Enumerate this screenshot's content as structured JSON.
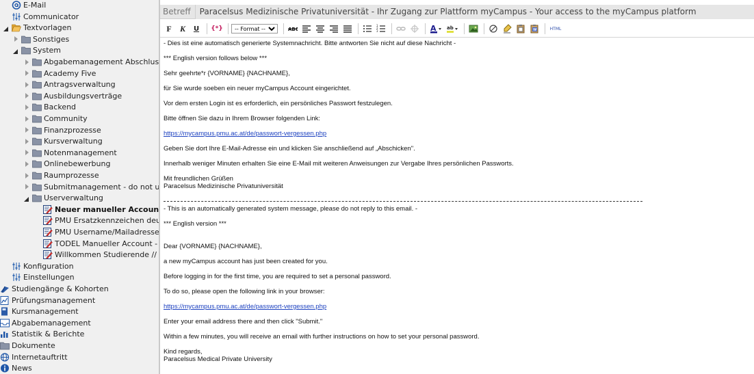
{
  "sidebar": {
    "items": [
      {
        "label": "E-Mail",
        "icon": "at-icon",
        "expander": "blank"
      },
      {
        "label": "Communicator",
        "icon": "sliders-icon",
        "expander": "blank"
      },
      {
        "label": "Textvorlagen",
        "icon": "folder-open-icon",
        "expander": "expanded"
      },
      {
        "label": "Sonstiges",
        "icon": "folder-icon",
        "expander": "collapsed"
      },
      {
        "label": "System",
        "icon": "folder-icon",
        "expander": "expanded"
      },
      {
        "label": "Abgabemanagement Abschlussar",
        "icon": "folder-icon",
        "expander": "collapsed"
      },
      {
        "label": "Academy Five",
        "icon": "folder-icon",
        "expander": "collapsed"
      },
      {
        "label": "Antragsverwaltung",
        "icon": "folder-icon",
        "expander": "collapsed"
      },
      {
        "label": "Ausbildungsverträge",
        "icon": "folder-icon",
        "expander": "collapsed"
      },
      {
        "label": "Backend",
        "icon": "folder-icon",
        "expander": "collapsed"
      },
      {
        "label": "Community",
        "icon": "folder-icon",
        "expander": "collapsed"
      },
      {
        "label": "Finanzprozesse",
        "icon": "folder-icon",
        "expander": "collapsed"
      },
      {
        "label": "Kursverwaltung",
        "icon": "folder-icon",
        "expander": "collapsed"
      },
      {
        "label": "Notenmanagement",
        "icon": "folder-icon",
        "expander": "collapsed"
      },
      {
        "label": "Onlinebewerbung",
        "icon": "folder-icon",
        "expander": "collapsed"
      },
      {
        "label": "Raumprozesse",
        "icon": "folder-icon",
        "expander": "collapsed"
      },
      {
        "label": "Submitmanagement - do not use",
        "icon": "folder-icon",
        "expander": "collapsed"
      },
      {
        "label": "Userverwaltung",
        "icon": "folder-icon",
        "expander": "expanded"
      },
      {
        "label": "Neuer manueller Account",
        "icon": "edit-template-icon",
        "expander": "blank",
        "active": true
      },
      {
        "label": "PMU Ersatzkennzeichen deuts",
        "icon": "edit-template-icon",
        "expander": "blank"
      },
      {
        "label": "PMU Username/Mailadresse v",
        "icon": "edit-template-icon",
        "expander": "blank"
      },
      {
        "label": "TODEL Manueller Account - m",
        "icon": "edit-template-icon",
        "expander": "blank"
      },
      {
        "label": "Willkommen Studierende // W",
        "icon": "edit-template-icon",
        "expander": "blank"
      },
      {
        "label": "Konfiguration",
        "icon": "sliders-icon",
        "expander": "blank"
      },
      {
        "label": "Einstellungen",
        "icon": "sliders-icon",
        "expander": "blank"
      },
      {
        "label": "Studiengänge & Kohorten",
        "icon": "graduation-icon",
        "expander": "none"
      },
      {
        "label": "Prüfungsmanagement",
        "icon": "chart-doc-icon",
        "expander": "none"
      },
      {
        "label": "Kursmanagement",
        "icon": "book-icon",
        "expander": "none"
      },
      {
        "label": "Abgabemanagement",
        "icon": "inbox-icon",
        "expander": "none"
      },
      {
        "label": "Statistik & Berichte",
        "icon": "bar-chart-icon",
        "expander": "none"
      },
      {
        "label": "Dokumente",
        "icon": "folder-icon",
        "expander": "none"
      },
      {
        "label": "Internetauftritt",
        "icon": "globe-icon",
        "expander": "none"
      },
      {
        "label": "News",
        "icon": "info-icon",
        "expander": "none"
      }
    ]
  },
  "subject": {
    "label": "Betreff",
    "value": "Paracelsus Medizinische Privatuniversität - Ihr Zugang zur Plattform myCampus - Your access to the myCampus platform"
  },
  "toolbar": {
    "bold": "F",
    "italic": "K",
    "underline": "U",
    "placeholder": "{*}",
    "format_option": "-- Format --",
    "html": "HTML"
  },
  "editor": {
    "lines": [
      "- Dies ist eine automatisch generierte Systemnachricht. Bitte antworten Sie nicht auf diese Nachricht -",
      "*** English version follows below ***",
      "Sehr geehrte*r {VORNAME} {NACHNAME},",
      "für Sie wurde soeben ein neuer myCampus Account eingerichtet.",
      "Vor dem ersten Login ist es erforderlich, ein persönliches Passwort festzulegen.",
      "Bitte öffnen Sie dazu in Ihrem Browser folgenden Link:",
      "https://mycampus.pmu.ac.at/de/passwort-vergessen.php",
      "Geben Sie dort Ihre E-Mail-Adresse ein und klicken Sie anschließend auf „Abschicken\".",
      "Innerhalb weniger Minuten erhalten Sie eine E-Mail mit weiteren Anweisungen zur Vergabe Ihres persönlichen Passworts.",
      "Mit freundlichen Grüßen",
      "Paracelsus Medizinische Privatuniversität",
      "- This is an automatically generated system message, please do not reply to this email. -",
      " *** English version ***",
      "Dear {VORNAME} {NACHNAME},",
      "a new myCampus account has just been created for you.",
      "Before logging in for the first time, you are required to set a personal password.",
      "To do so, please open the following link in your browser:",
      "https://mycampus.pmu.ac.at/de/passwort-vergessen.php",
      "Enter your email address there and then click \"Submit.\"",
      "Within a few minutes, you will receive an email with further instructions on how to set your personal password.",
      "Kind regards,",
      "Paracelsus Medical Private University"
    ]
  }
}
